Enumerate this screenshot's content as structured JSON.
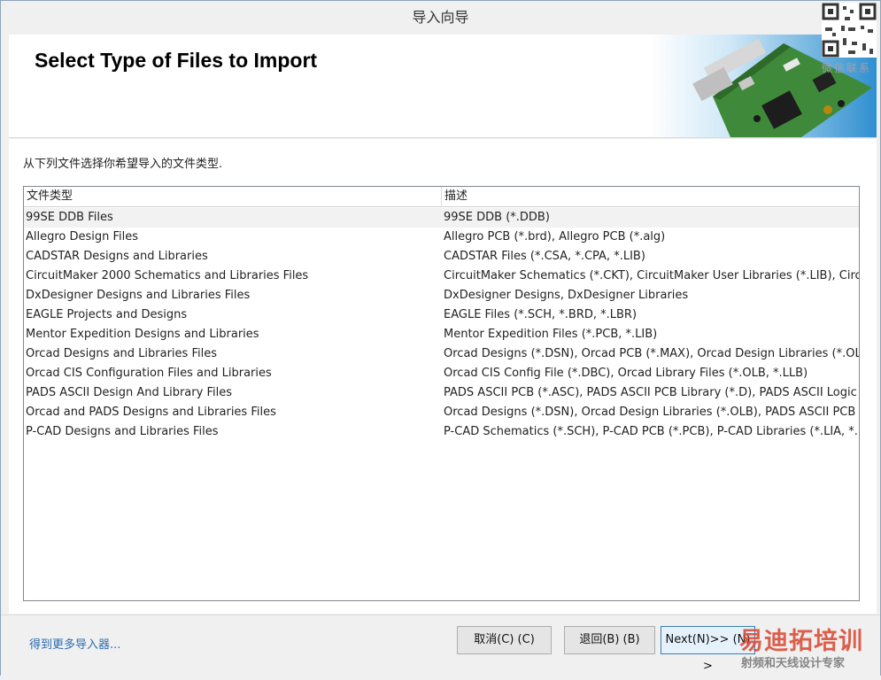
{
  "window": {
    "title": "导入向导"
  },
  "header": {
    "title": "Select Type of Files to Import"
  },
  "instruction": "从下列文件选择你希望导入的文件类型.",
  "filelist": {
    "columns": [
      "文件类型",
      "描述"
    ],
    "selected_index": 0,
    "rows": [
      {
        "type": "99SE DDB Files",
        "desc": "99SE DDB (*.DDB)"
      },
      {
        "type": "Allegro Design Files",
        "desc": "Allegro PCB (*.brd), Allegro PCB (*.alg)"
      },
      {
        "type": "CADSTAR Designs and Libraries",
        "desc": "CADSTAR Files (*.CSA, *.CPA, *.LIB)"
      },
      {
        "type": "CircuitMaker 2000 Schematics and Libraries Files",
        "desc": "CircuitMaker Schematics (*.CKT), CircuitMaker User Libraries (*.LIB), CircuitMa"
      },
      {
        "type": "DxDesigner Designs and Libraries Files",
        "desc": "DxDesigner Designs, DxDesigner Libraries"
      },
      {
        "type": "EAGLE Projects and Designs",
        "desc": "EAGLE Files (*.SCH, *.BRD, *.LBR)"
      },
      {
        "type": "Mentor Expedition Designs and Libraries",
        "desc": "Mentor Expedition Files (*.PCB, *.LIB)"
      },
      {
        "type": "Orcad Designs and Libraries Files",
        "desc": "Orcad Designs (*.DSN), Orcad PCB (*.MAX), Orcad Design Libraries (*.OLB), C"
      },
      {
        "type": "Orcad CIS Configuration Files and Libraries",
        "desc": "Orcad CIS Config File (*.DBC), Orcad Library Files (*.OLB, *.LLB)"
      },
      {
        "type": "PADS ASCII Design And Library Files",
        "desc": "PADS ASCII PCB (*.ASC), PADS ASCII PCB Library (*.D), PADS ASCII Logic (*.T"
      },
      {
        "type": "Orcad and PADS Designs and Libraries Files",
        "desc": "Orcad Designs (*.DSN), Orcad Design Libraries (*.OLB), PADS ASCII PCB (*.AS"
      },
      {
        "type": "P-CAD Designs and Libraries Files",
        "desc": "P-CAD Schematics (*.SCH), P-CAD PCB (*.PCB), P-CAD Libraries (*.LIA, *.LIB)"
      }
    ]
  },
  "footer": {
    "more_link": "得到更多导入器...",
    "cancel_label": "取消(C) (C)",
    "back_label": "退回(B) (B)",
    "next_label": "Next(N)>> (N) >"
  },
  "overlay": {
    "qr_label": "微信联系",
    "watermark_big": "易迪拓培训",
    "watermark_small": "射频和天线设计专家"
  },
  "colors": {
    "link": "#2b6cb0",
    "watermark": "#d9452f",
    "focus_border": "#3c7fb1"
  }
}
